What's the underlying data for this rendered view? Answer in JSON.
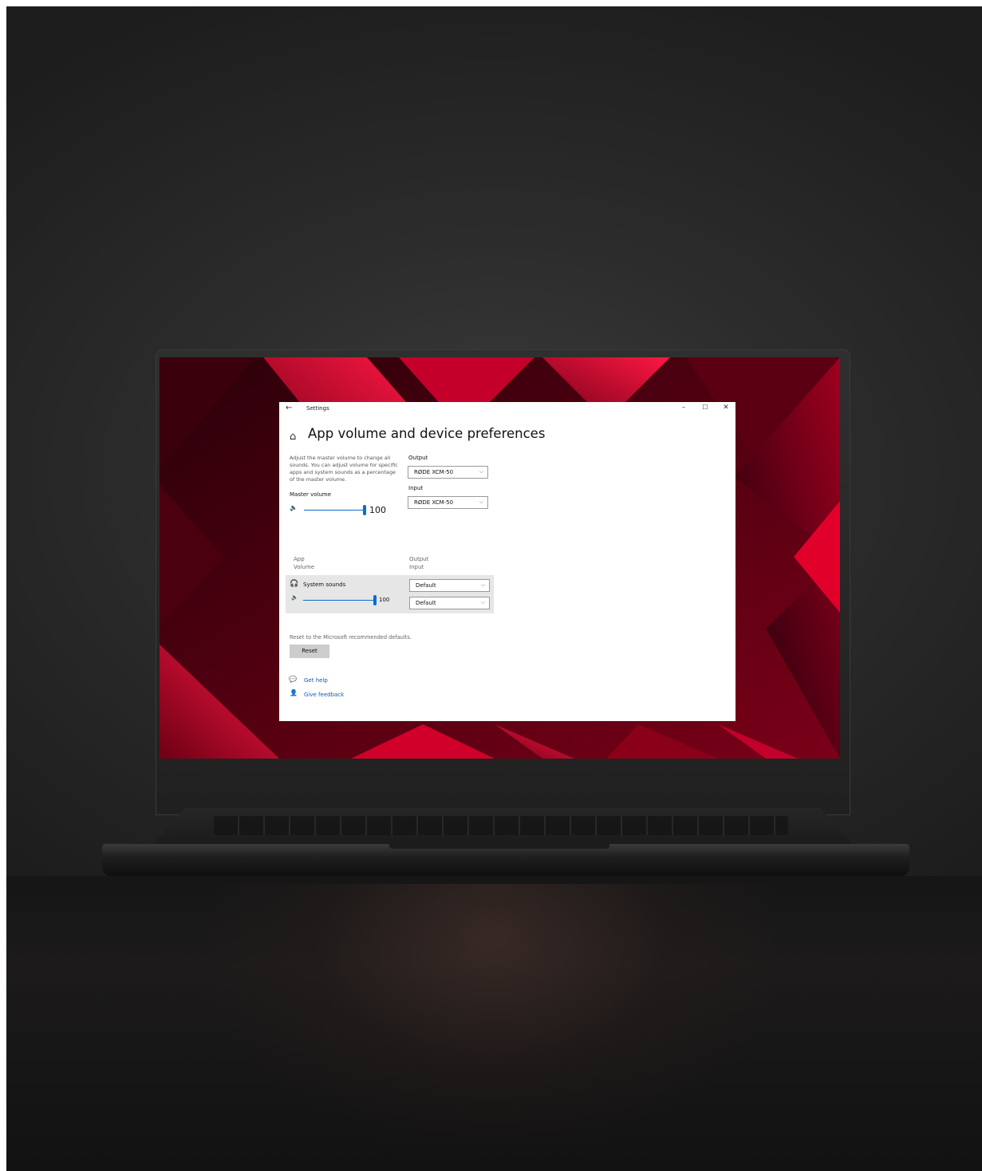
{
  "window": {
    "title": "Settings",
    "back_icon": "back-arrow-icon",
    "minimize": "–",
    "maximize": "☐",
    "close": "✕"
  },
  "page": {
    "home_icon": "home-icon",
    "title": "App volume and device preferences",
    "description": "Adjust the master volume to change all sounds. You can adjust volume for specific apps and system sounds as a percentage of the master volume."
  },
  "master": {
    "label": "Master volume",
    "value": "100",
    "level": 1.0
  },
  "output": {
    "label": "Output",
    "selected": "RØDE XCM-50"
  },
  "input": {
    "label": "Input",
    "selected": "RØDE XCM-50"
  },
  "app_table": {
    "col_app": "App",
    "col_volume": "Volume",
    "col_output": "Output",
    "col_input": "Input",
    "rows": [
      {
        "name": "System sounds",
        "icon": "headphones-icon",
        "volume": "100",
        "level": 1.0,
        "output": "Default",
        "input": "Default"
      }
    ]
  },
  "reset": {
    "description": "Reset to the Microsoft recommended defaults.",
    "button": "Reset"
  },
  "links": {
    "help": "Get help",
    "feedback": "Give feedback"
  },
  "colors": {
    "accent": "#0a6ccf",
    "wallpaper_red": "#e0002a",
    "link": "#0a5fb4"
  }
}
